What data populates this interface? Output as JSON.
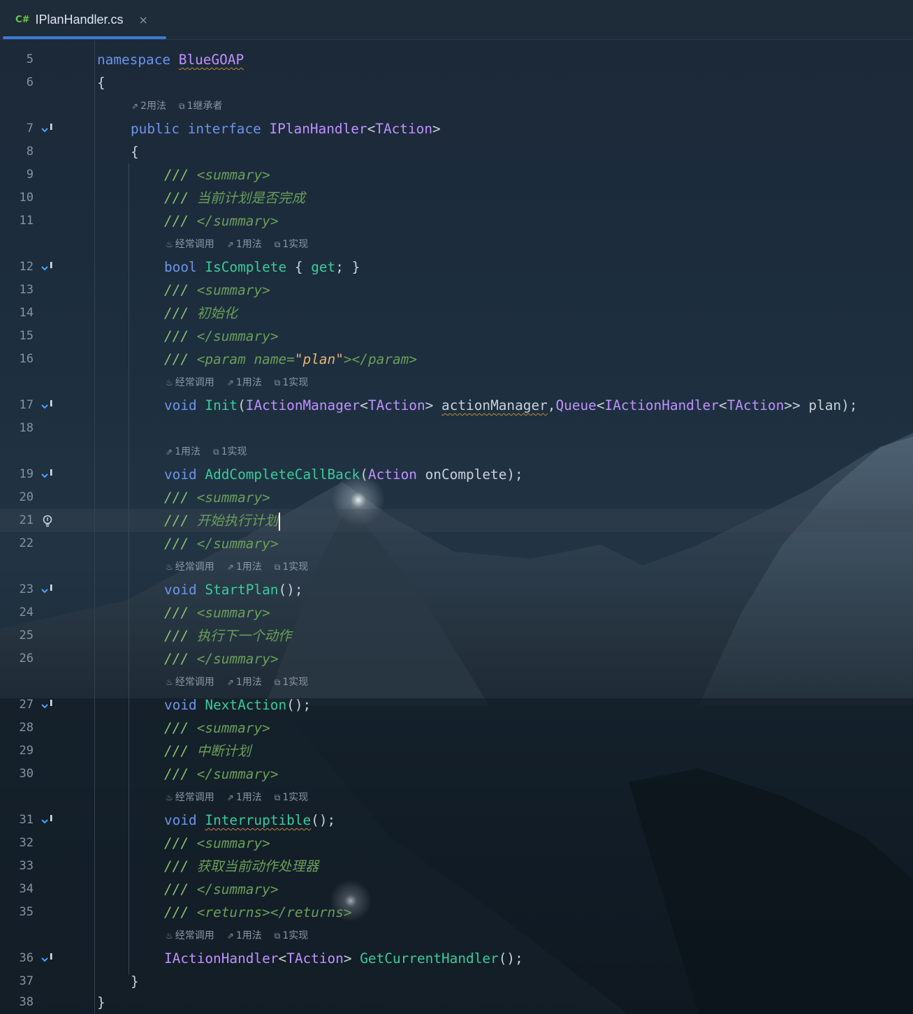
{
  "tab": {
    "lang_badge": "C#",
    "filename": "IPlanHandler.cs",
    "close_glyph": "×"
  },
  "hints": {
    "frequent": "经常调用",
    "usages_1": "1用法",
    "usages_2": "2用法",
    "impl_1": "1实现",
    "inheritor_1": "1继承者"
  },
  "lines": [
    {
      "n": "5"
    },
    {
      "n": "6"
    },
    {
      "n": "7"
    },
    {
      "n": "8"
    },
    {
      "n": "9"
    },
    {
      "n": "10"
    },
    {
      "n": "11"
    },
    {
      "n": "12"
    },
    {
      "n": "13"
    },
    {
      "n": "14"
    },
    {
      "n": "15"
    },
    {
      "n": "16"
    },
    {
      "n": "17"
    },
    {
      "n": "18"
    },
    {
      "n": "19"
    },
    {
      "n": "20"
    },
    {
      "n": "21"
    },
    {
      "n": "22"
    },
    {
      "n": "23"
    },
    {
      "n": "24"
    },
    {
      "n": "25"
    },
    {
      "n": "26"
    },
    {
      "n": "27"
    },
    {
      "n": "28"
    },
    {
      "n": "29"
    },
    {
      "n": "30"
    },
    {
      "n": "31"
    },
    {
      "n": "32"
    },
    {
      "n": "33"
    },
    {
      "n": "34"
    },
    {
      "n": "35"
    },
    {
      "n": "36"
    },
    {
      "n": "37"
    },
    {
      "n": "38"
    }
  ],
  "tokens": {
    "namespace_kw": "namespace",
    "namespace_name": "BlueGOAP",
    "brace_open": "{",
    "brace_close": "}",
    "public_kw": "public",
    "interface_kw": "interface",
    "interface_name": "IPlanHandler",
    "taction": "TAction",
    "lt": "<",
    "gt": ">",
    "doc_prefix": "///",
    "summary_open_l": "<",
    "summary_word": "summary",
    "summary_open_r": ">",
    "summary_close_l": "</",
    "c_is_complete": "当前计划是否完成",
    "bool_kw": "bool",
    "is_complete": "IsComplete",
    "get_kw": "get",
    "c_init": "初始化",
    "param_word": "param",
    "name_attr": "name",
    "eq": "=",
    "plan_str": "\"plan\"",
    "param_close": "></",
    "void_kw": "void",
    "init_fn": "Init",
    "iaction_manager": "IActionManager",
    "action_manager_param": "actionManager",
    "queue": "Queue",
    "iaction_handler": "IActionHandler",
    "plan_param": "plan",
    "add_complete": "AddCompleteCallBack",
    "action_type": "Action",
    "on_complete": "onComplete",
    "c_start": "开始执行计划",
    "start_plan": "StartPlan",
    "c_next": "执行下一个动作",
    "next_action": "NextAction",
    "c_interrupt": "中断计划",
    "interruptible": "Interruptible",
    "c_get_current": "获取当前动作处理器",
    "returns_word": "returns",
    "get_current_handler": "GetCurrentHandler"
  }
}
